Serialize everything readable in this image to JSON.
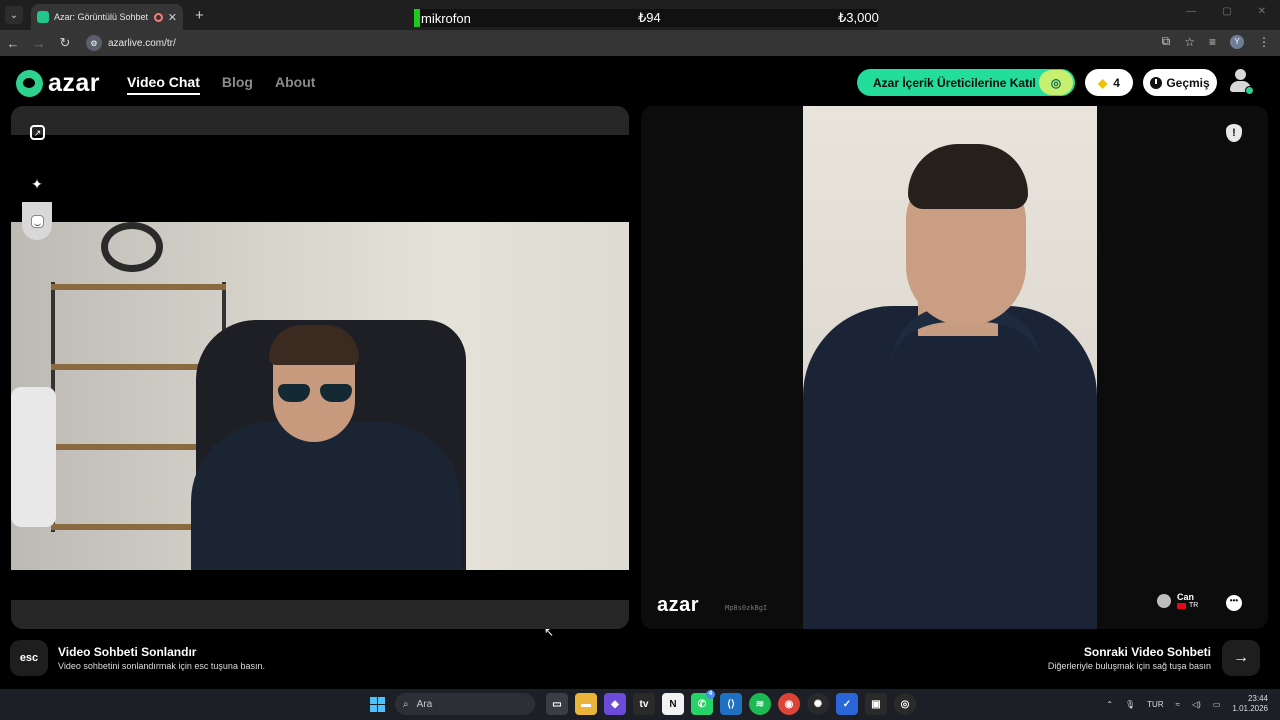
{
  "browser": {
    "tab_title": "Azar: Görüntülü Sohbet & V",
    "url": "azarlive.com/tr/",
    "profile_initial": "Y"
  },
  "overlay": {
    "mic_label": "mikrofon",
    "value_1": "₺94",
    "value_2": "₺3,000"
  },
  "header": {
    "logo_text": "azar",
    "nav": [
      "Video Chat",
      "Blog",
      "About"
    ],
    "creator_button": "Azar İçerik Üreticilerine Katıl",
    "gem_count": "4",
    "history_button": "Geçmiş"
  },
  "partner": {
    "watermark_logo": "azar",
    "watermark_code": "Mp8s0zkBgI",
    "name": "Can",
    "country": "TR"
  },
  "footer": {
    "esc_key": "esc",
    "end_title": "Video Sohbeti Sonlandır",
    "end_desc": "Video sohbetini sonlandırmak için esc tuşuna basın.",
    "next_title": "Sonraki Video Sohbeti",
    "next_desc": "Diğerleriyle buluşmak için sağ tuşa basın"
  },
  "taskbar": {
    "search_placeholder": "Ara",
    "whatsapp_badge": "4",
    "language": "TUR",
    "time": "23:44",
    "date": "1.01.2026"
  },
  "colors": {
    "brand_green": "#22dd9b",
    "panel_bg": "#262626"
  }
}
